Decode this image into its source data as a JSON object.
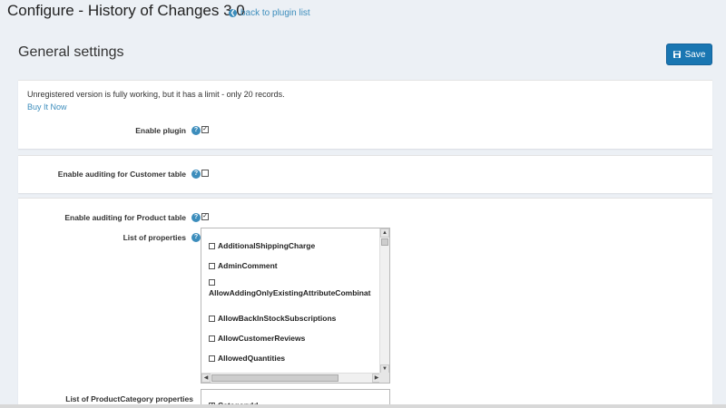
{
  "header": {
    "title": "Configure - History of Changes 3.0",
    "back_link": "back to plugin list"
  },
  "general": {
    "title": "General settings",
    "save_label": "Save"
  },
  "notice": {
    "text": "Unregistered version is fully working, but it has a limit - only 20 records.",
    "buy_link": "Buy It Now"
  },
  "settings": {
    "enable_plugin": {
      "label": "Enable plugin",
      "checked": true
    },
    "customer_auditing": {
      "label": "Enable auditing for Customer table",
      "checked": false
    },
    "product_auditing": {
      "label": "Enable auditing for Product table",
      "checked": true
    },
    "list_properties": {
      "label": "List of properties"
    },
    "category_properties": {
      "label": "List of ProductCategory properties"
    }
  },
  "properties": [
    {
      "name": "AdditionalShippingCharge",
      "checked": false
    },
    {
      "name": "AdminComment",
      "checked": false
    },
    {
      "name": "AllowAddingOnlyExistingAttributeCombinat",
      "checked": false
    },
    {
      "name": "AllowBackInStockSubscriptions",
      "checked": false
    },
    {
      "name": "AllowCustomerReviews",
      "checked": false
    },
    {
      "name": "AllowedQuantities",
      "checked": false
    }
  ],
  "category_properties": [
    {
      "name": "CategoryId",
      "checked": true
    }
  ],
  "icons": {
    "help": "question-circle-icon",
    "save": "floppy-disk-icon",
    "back": "arrow-circle-left-icon"
  },
  "colors": {
    "accent": "#3c8dbc",
    "save_button": "#1976b2",
    "background": "#ecf0f5"
  }
}
